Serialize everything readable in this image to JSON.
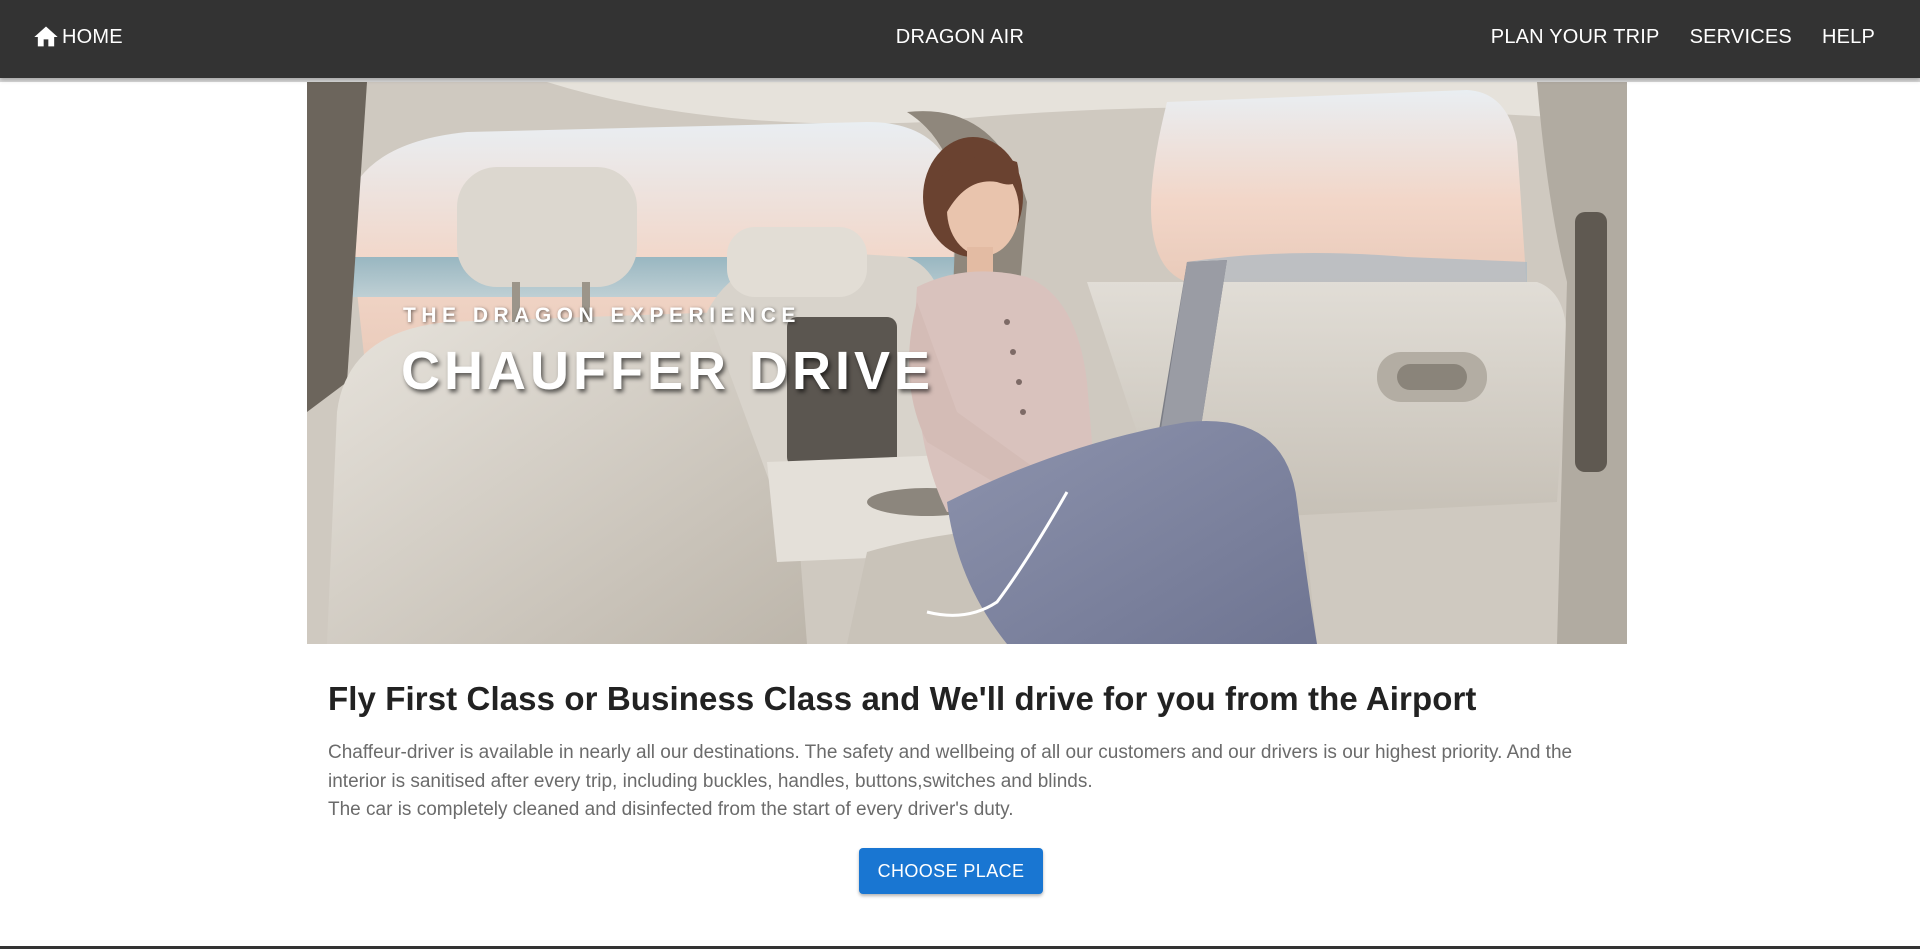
{
  "header": {
    "home_label": "HOME",
    "brand": "DRAGON AIR",
    "nav": [
      {
        "label": "PLAN YOUR TRIP"
      },
      {
        "label": "SERVICES"
      },
      {
        "label": "HELP"
      }
    ],
    "home_icon": "home-icon"
  },
  "hero": {
    "kicker": "THE DRAGON EXPERIENCE",
    "title": "CHAUFFER DRIVE"
  },
  "content": {
    "headline": "Fly First Class or Business Class and We'll drive for you from the Airport",
    "paragraph_1": "Chaffeur-driver is available in nearly all our destinations. The safety and wellbeing of all our customers and our drivers is our highest priority. And the interior is sanitised after every trip, including buckles, handles, buttons,switches and blinds.",
    "paragraph_2": "The car is completely cleaned and disinfected from the start of every driver's duty.",
    "cta_label": "CHOOSE PLACE"
  },
  "colors": {
    "appbar": "#333333",
    "accent": "#1976d2",
    "body_text": "#6b6b6b",
    "headline": "#222222"
  }
}
